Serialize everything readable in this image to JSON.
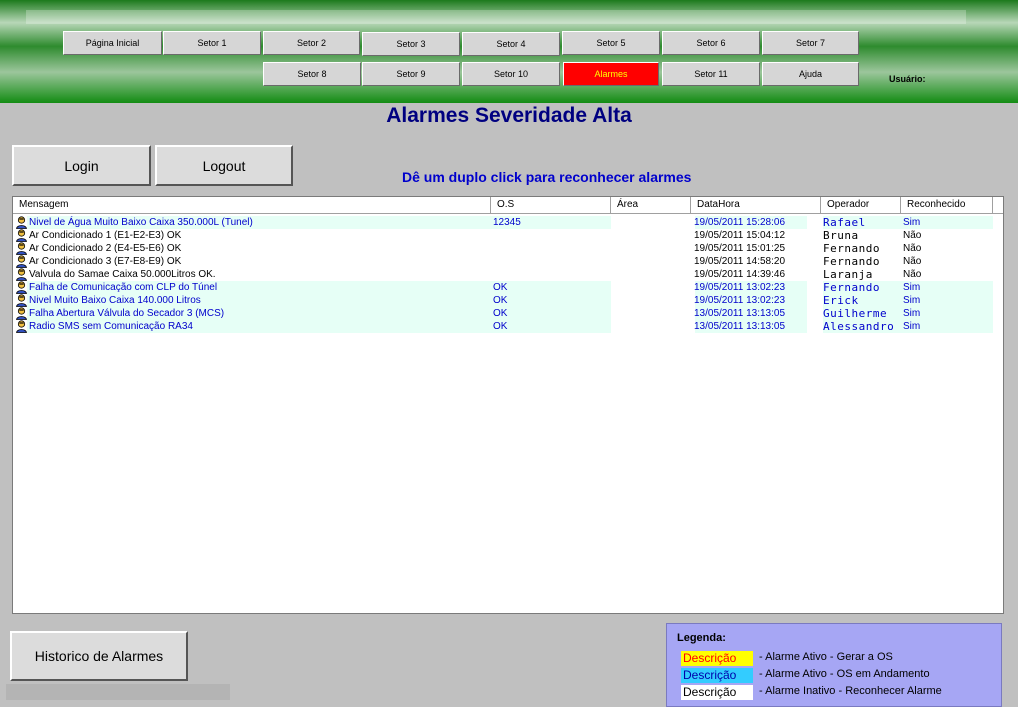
{
  "nav": {
    "row1": [
      "Página Inicial",
      "Setor 1",
      "Setor 2",
      "Setor 3",
      "Setor 4",
      "Setor 5",
      "Setor 6",
      "Setor 7"
    ],
    "row2": [
      "Setor 8",
      "Setor 9",
      "Setor 10",
      "Alarmes",
      "Setor 11",
      "Ajuda"
    ],
    "active": "Alarmes",
    "user_label": "Usuário:"
  },
  "page": {
    "title": "Alarmes Severidade Alta",
    "login_label": "Login",
    "logout_label": "Logout",
    "hint": "Dê um duplo click para reconhecer alarmes",
    "history_label": "Historico de Alarmes"
  },
  "table": {
    "columns": [
      "Mensagem",
      "O.S",
      "Área",
      "DataHora",
      "Operador",
      "Reconhecido"
    ],
    "rows": [
      {
        "msg": "Nivel de Água Muito Baixo Caixa 350.000L (Tunel)",
        "os": "12345",
        "area": "",
        "datetime": "19/05/2011 15:28:06",
        "operator": "Rafael",
        "ack": "Sim",
        "state": "os"
      },
      {
        "msg": "Ar Condicionado 1 (E1-E2-E3) OK",
        "os": "",
        "area": "",
        "datetime": "19/05/2011 15:04:12",
        "operator": "Bruna",
        "ack": "Não",
        "state": "inactive"
      },
      {
        "msg": "Ar Condicionado 2 (E4-E5-E6) OK",
        "os": "",
        "area": "",
        "datetime": "19/05/2011 15:01:25",
        "operator": "Fernando",
        "ack": "Não",
        "state": "inactive"
      },
      {
        "msg": "Ar Condicionado 3 (E7-E8-E9) OK",
        "os": "",
        "area": "",
        "datetime": "19/05/2011 14:58:20",
        "operator": "Fernando",
        "ack": "Não",
        "state": "inactive"
      },
      {
        "msg": "Valvula do Samae Caixa 50.000Litros OK.",
        "os": "",
        "area": "",
        "datetime": "19/05/2011 14:39:46",
        "operator": "Laranja",
        "ack": "Não",
        "state": "inactive"
      },
      {
        "msg": "Falha de Comunicação com CLP do Túnel",
        "os": "OK",
        "area": "",
        "datetime": "19/05/2011 13:02:23",
        "operator": "Fernando",
        "ack": "Sim",
        "state": "os"
      },
      {
        "msg": "Nivel Muito Baixo Caixa 140.000 Litros",
        "os": "OK",
        "area": "",
        "datetime": "19/05/2011 13:02:23",
        "operator": "Erick",
        "ack": "Sim",
        "state": "os"
      },
      {
        "msg": "Falha Abertura Válvula do Secador 3 (MCS)",
        "os": "OK",
        "area": "",
        "datetime": "13/05/2011 13:13:05",
        "operator": "Guilherme",
        "ack": "Sim",
        "state": "os"
      },
      {
        "msg": "Radio SMS sem Comunicação RA34",
        "os": "OK",
        "area": "",
        "datetime": "13/05/2011 13:13:05",
        "operator": "Alessandro",
        "ack": "Sim",
        "state": "os"
      }
    ]
  },
  "legend": {
    "title": "Legenda:",
    "items": [
      {
        "swatch": "Descrição",
        "text": "- Alarme Ativo - Gerar a OS",
        "bg": "#ffff00",
        "fg": "#ff0000"
      },
      {
        "swatch": "Descrição",
        "text": "- Alarme Ativo - OS em Andamento",
        "bg": "#33ccff",
        "fg": "#0000aa"
      },
      {
        "swatch": "Descrição",
        "text": "- Alarme Inativo - Reconhecer Alarme",
        "bg": "#ffffff",
        "fg": "#000000"
      }
    ]
  },
  "colors": {
    "active_os_row_bg": "#e6fff6",
    "active_os_text": "#0000cc",
    "inactive_text": "#000000",
    "title_color": "#000080",
    "hint_color": "#0000cc",
    "active_tab_bg": "#ff0000",
    "active_tab_fg": "#ffff00"
  },
  "icons": {
    "row_icon": "user-alarm-icon"
  }
}
